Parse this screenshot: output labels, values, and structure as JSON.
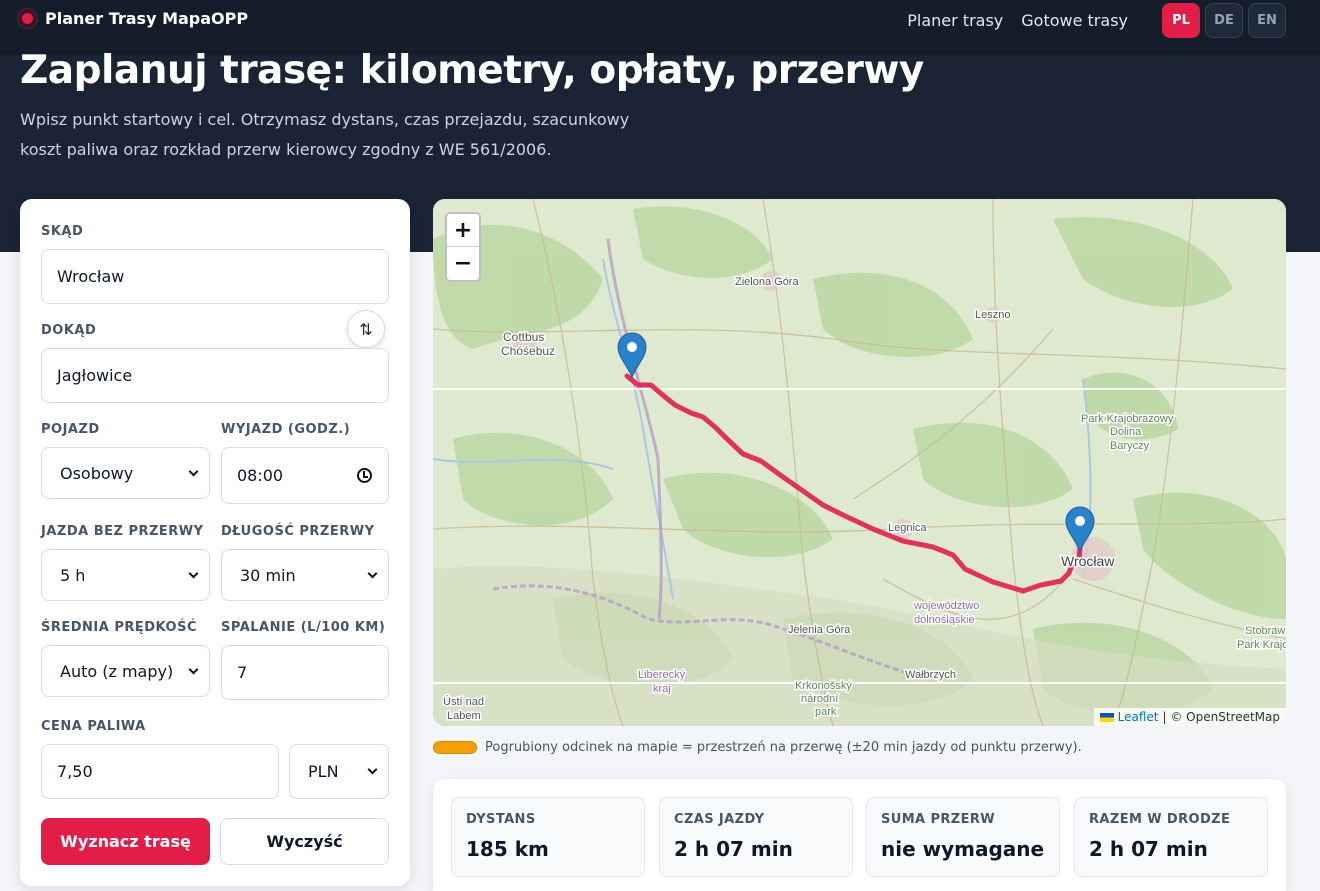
{
  "header": {
    "brand": "Planer Trasy MapaOPP",
    "nav": [
      "Planer trasy",
      "Gotowe trasy"
    ],
    "langs": [
      "PL",
      "DE",
      "EN"
    ],
    "active_lang": "PL"
  },
  "hero": {
    "title": "Zaplanuj trasę: kilometry, opłaty, przerwy",
    "subtitle": "Wpisz punkt startowy i cel. Otrzymasz dystans, czas przejazdu, szacunkowy koszt paliwa oraz rozkład przerw kierowcy zgodny z WE 561/2006."
  },
  "form": {
    "from_label": "SKĄD",
    "from_value": "Wrocław",
    "to_label": "DOKĄD",
    "to_value": "Jagłowice",
    "swap_icon": "⇅",
    "vehicle_label": "POJAZD",
    "vehicle_value": "Osobowy",
    "departure_label": "WYJAZD (GODZ.)",
    "departure_value": "08:00",
    "drive_label": "JAZDA BEZ PRZERWY",
    "drive_value": "5 h",
    "break_label": "DŁUGOŚĆ PRZERWY",
    "break_value": "30 min",
    "speed_label": "ŚREDNIA PRĘDKOŚĆ",
    "speed_value": "Auto (z mapy)",
    "consumption_label": "SPALANIE (L/100 KM)",
    "consumption_value": "7",
    "price_label": "CENA PALIWA",
    "price_value": "7,50",
    "currency_value": "PLN",
    "submit": "Wyznacz trasę",
    "clear": "Wyczyść"
  },
  "map": {
    "zoom_in": "+",
    "zoom_out": "−",
    "places": [
      "Zielona Góra",
      "Leszno",
      "Cottbus",
      "Chóśebuz",
      "Park Krajobrazowy",
      "Dolina",
      "Baryczy",
      "Legnica",
      "Wrocław",
      "województwo",
      "dolnośląskie",
      "Jelenia Góra",
      "Wałbrzych",
      "Liberecký",
      "kraj",
      "Krkonošský",
      "národní",
      "park",
      "Ústí nad",
      "Labem",
      "Stobraw",
      "Park Krajob"
    ],
    "attribution_leaflet": "Leaflet",
    "attribution_osm": "| © OpenStreetMap",
    "route_color": "#e0234e"
  },
  "legend": {
    "text": "Pogrubiony odcinek na mapie = przestrzeń na przerwę (±20 min jazdy od punktu przerwy).",
    "color": "#f59e0b"
  },
  "stats": [
    {
      "label": "DYSTANS",
      "value": "185 km"
    },
    {
      "label": "CZAS JAZDY",
      "value": "2 h 07 min"
    },
    {
      "label": "SUMA PRZERW",
      "value": "nie wymagane"
    },
    {
      "label": "RAZEM W DRODZE",
      "value": "2 h 07 min"
    }
  ]
}
